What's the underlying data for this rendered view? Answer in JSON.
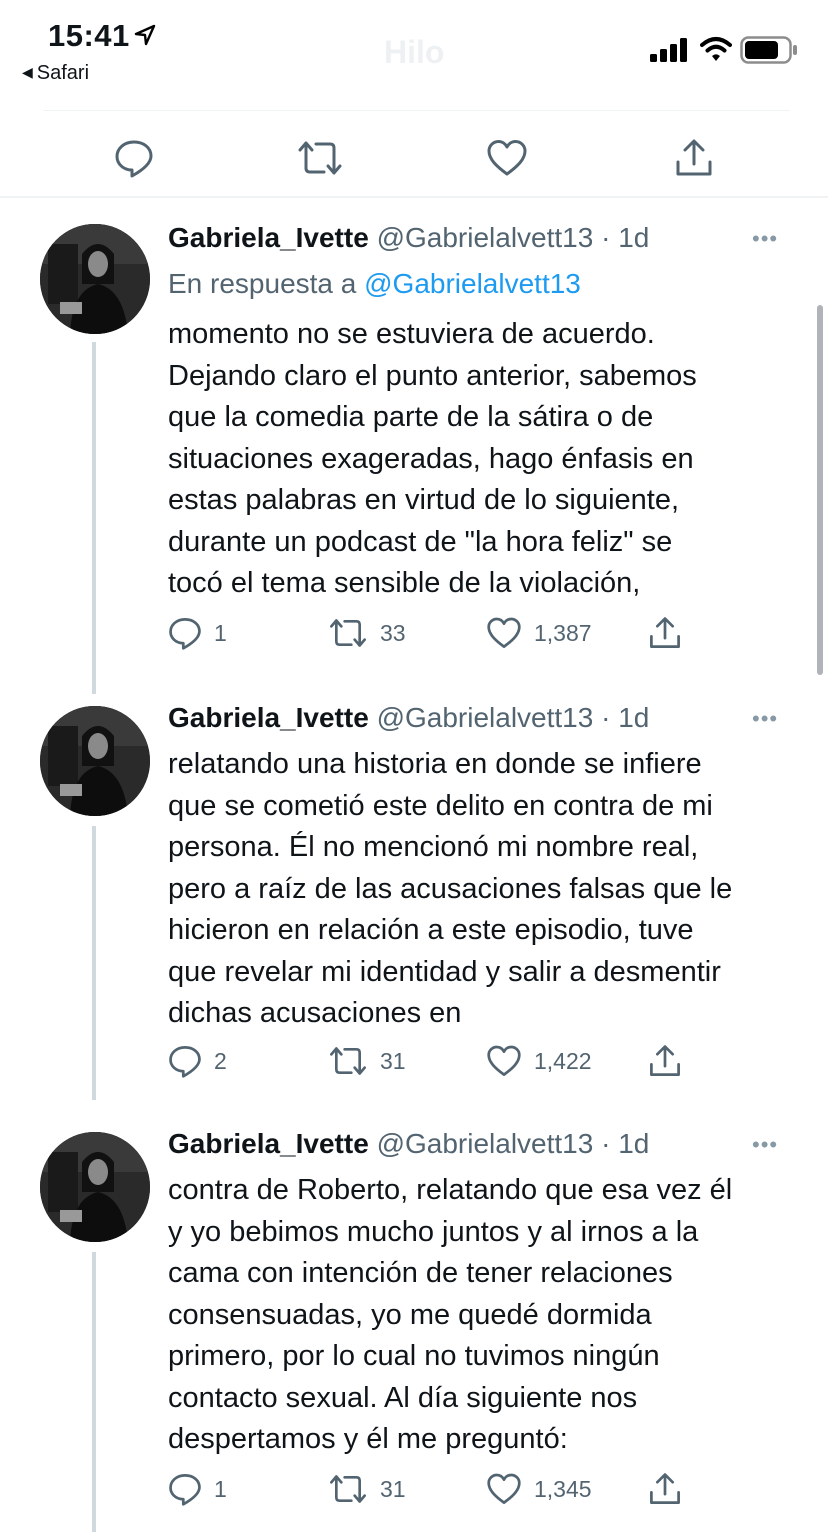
{
  "status_bar": {
    "time": "15:41",
    "back_label": "Safari",
    "ghost_title": "Hilo"
  },
  "icons": {
    "reply": "reply-icon",
    "retweet": "retweet-icon",
    "like": "heart-icon",
    "share": "share-icon",
    "more": "more-icon"
  },
  "colors": {
    "accent": "#1d9bf0",
    "secondary_text": "#536471",
    "thread_line": "#cfd9de"
  },
  "tweets": [
    {
      "name": "Gabriela_Ivette",
      "handle": "@Gabrielalvett13 · 1d",
      "reply_prefix": "En respuesta a",
      "reply_mention": "@Gabrielalvett13",
      "lines": [
        "momento no se estuviera de acuerdo.",
        "Dejando claro el punto anterior, sabemos",
        "que la comedia parte de la sátira o de",
        "situaciones exageradas, hago énfasis en",
        "estas palabras en virtud de lo siguiente,",
        "durante un podcast de \"la hora feliz\" se",
        "tocó el tema sensible de la violación,"
      ],
      "replies": "1",
      "retweets": "33",
      "likes": "1,387"
    },
    {
      "name": "Gabriela_Ivette",
      "handle": "@Gabrielalvett13 · 1d",
      "lines": [
        "relatando una historia en donde se infiere",
        "que se cometió este delito en contra de mi",
        "persona. Él no mencionó mi nombre real,",
        "pero a raíz de las acusaciones falsas que le",
        "hicieron en relación a este episodio, tuve",
        "que revelar mi identidad y salir a desmentir",
        "dichas acusaciones en"
      ],
      "replies": "2",
      "retweets": "31",
      "likes": "1,422"
    },
    {
      "name": "Gabriela_Ivette",
      "handle": "@Gabrielalvett13 · 1d",
      "lines": [
        "contra de Roberto, relatando que esa vez él",
        "y yo bebimos mucho juntos y al irnos a la",
        "cama con intención de tener relaciones",
        "consensuadas, yo me quedé dormida",
        "primero, por lo cual no tuvimos ningún",
        "contacto sexual. Al día siguiente nos",
        "despertamos y él me preguntó:"
      ],
      "replies": "1",
      "retweets": "31",
      "likes": "1,345"
    }
  ]
}
